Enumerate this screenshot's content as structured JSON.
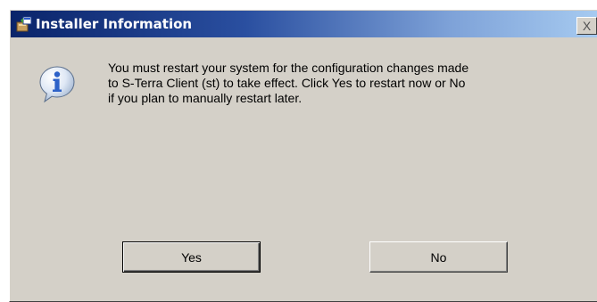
{
  "window": {
    "title": "Installer Information",
    "title_icon": "installer-icon",
    "close_label": "X"
  },
  "dialog": {
    "icon": "info-icon",
    "message_lines": [
      "You must restart your system for the configuration changes made",
      "to S-Terra Client (st) to take effect. Click Yes to restart now or No",
      "if you plan to manually restart later."
    ]
  },
  "buttons": {
    "yes_label": "Yes",
    "no_label": "No"
  },
  "colors": {
    "dialog_bg": "#d4d0c8",
    "titlebar_start": "#0a246a",
    "titlebar_end": "#a6caf0",
    "info_icon_blue": "#2e62c8"
  }
}
